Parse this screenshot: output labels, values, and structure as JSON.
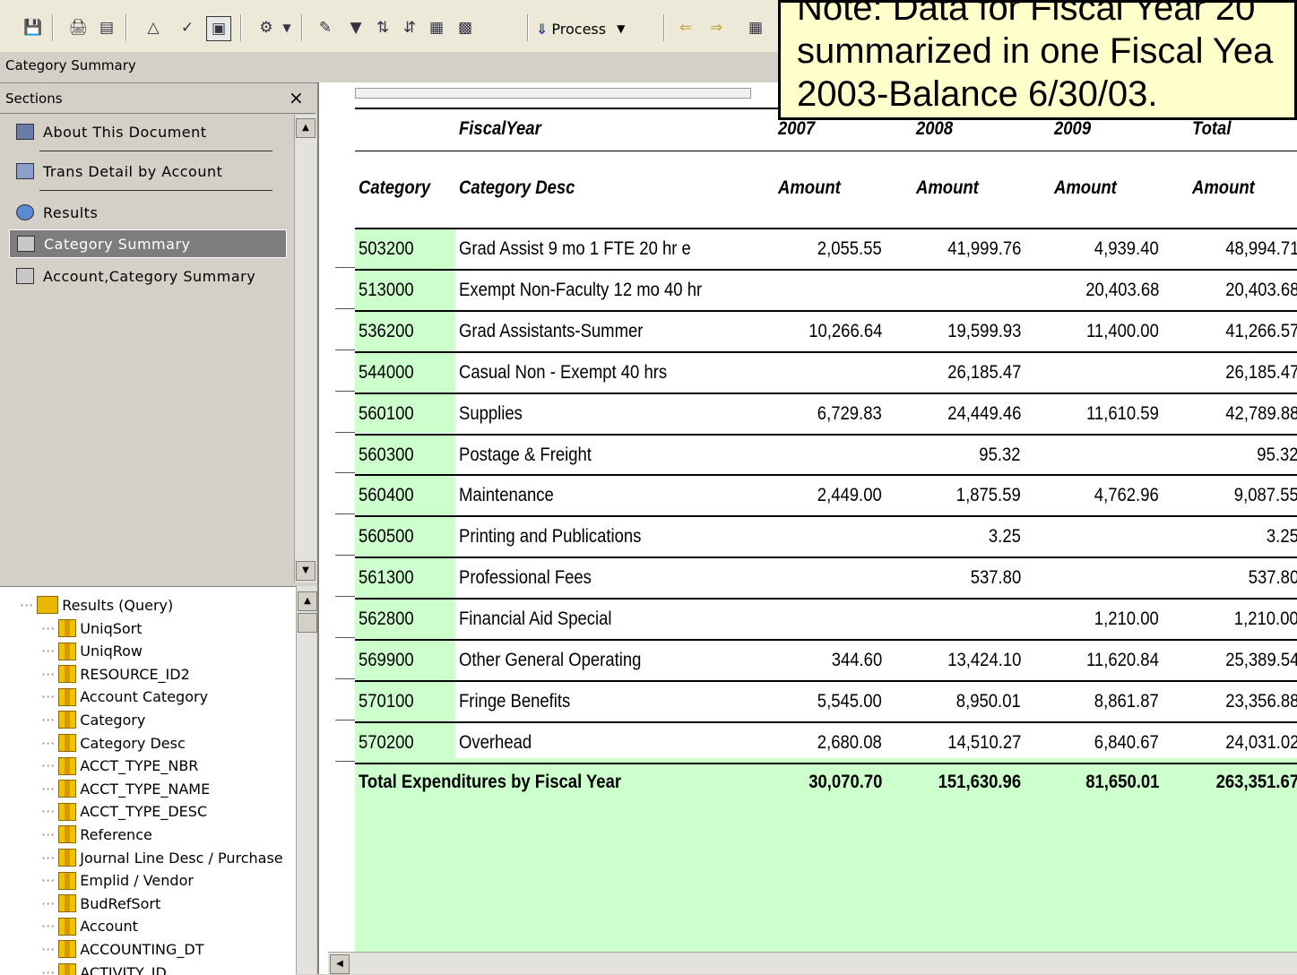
{
  "toolbar": {
    "process_label": "Process"
  },
  "window": {
    "title": "Category Summary"
  },
  "sections": {
    "header": "Sections",
    "close_glyph": "×",
    "items": [
      {
        "label": "About This Document",
        "icon": "document-info-icon"
      },
      {
        "label": "Trans Detail by Account",
        "icon": "report-icon"
      },
      {
        "label": "Results",
        "icon": "query-icon"
      },
      {
        "label": "Category Summary",
        "icon": "table-report-icon",
        "selected": true
      },
      {
        "label": "Account,Category Summary",
        "icon": "table-report-icon"
      }
    ]
  },
  "tree": {
    "root": "Results (Query)",
    "columns": [
      "UniqSort",
      "UniqRow",
      "RESOURCE_ID2",
      "Account Category",
      "Category",
      "Category Desc",
      "ACCT_TYPE_NBR",
      "ACCT_TYPE_NAME",
      "ACCT_TYPE_DESC",
      "Reference",
      "Journal Line Desc / Purchase",
      "Emplid / Vendor",
      "BudRefSort",
      "Account",
      "ACCOUNTING_DT",
      "ACTIVITY_ID"
    ]
  },
  "report": {
    "fiscal_year_label": "FiscalYear",
    "years": [
      "2007",
      "2008",
      "2009",
      "Total"
    ],
    "col_category": "Category",
    "col_desc": "Category Desc",
    "col_amount": "Amount",
    "rows": [
      {
        "code": "503200",
        "desc": "Grad Assist 9 mo 1 FTE 20 hr e",
        "y2007": "2,055.55",
        "y2008": "41,999.76",
        "y2009": "4,939.40",
        "total": "48,994.71"
      },
      {
        "code": "513000",
        "desc": "Exempt Non-Faculty 12 mo 40 hr",
        "y2007": "",
        "y2008": "",
        "y2009": "20,403.68",
        "total": "20,403.68"
      },
      {
        "code": "536200",
        "desc": "Grad Assistants-Summer",
        "y2007": "10,266.64",
        "y2008": "19,599.93",
        "y2009": "11,400.00",
        "total": "41,266.57"
      },
      {
        "code": "544000",
        "desc": "Casual Non - Exempt  40 hrs",
        "y2007": "",
        "y2008": "26,185.47",
        "y2009": "",
        "total": "26,185.47"
      },
      {
        "code": "560100",
        "desc": "Supplies",
        "y2007": "6,729.83",
        "y2008": "24,449.46",
        "y2009": "11,610.59",
        "total": "42,789.88"
      },
      {
        "code": "560300",
        "desc": "Postage & Freight",
        "y2007": "",
        "y2008": "95.32",
        "y2009": "",
        "total": "95.32"
      },
      {
        "code": "560400",
        "desc": "Maintenance",
        "y2007": "2,449.00",
        "y2008": "1,875.59",
        "y2009": "4,762.96",
        "total": "9,087.55"
      },
      {
        "code": "560500",
        "desc": "Printing and Publications",
        "y2007": "",
        "y2008": "3.25",
        "y2009": "",
        "total": "3.25"
      },
      {
        "code": "561300",
        "desc": "Professional Fees",
        "y2007": "",
        "y2008": "537.80",
        "y2009": "",
        "total": "537.80"
      },
      {
        "code": "562800",
        "desc": "Financial Aid Special",
        "y2007": "",
        "y2008": "",
        "y2009": "1,210.00",
        "total": "1,210.00"
      },
      {
        "code": "569900",
        "desc": "Other General Operating",
        "y2007": "344.60",
        "y2008": "13,424.10",
        "y2009": "11,620.84",
        "total": "25,389.54"
      },
      {
        "code": "570100",
        "desc": "Fringe Benefits",
        "y2007": "5,545.00",
        "y2008": "8,950.01",
        "y2009": "8,861.87",
        "total": "23,356.88"
      },
      {
        "code": "570200",
        "desc": "Overhead",
        "y2007": "2,680.08",
        "y2008": "14,510.27",
        "y2009": "6,840.67",
        "total": "24,031.02"
      }
    ],
    "totals": {
      "label": "Total Expenditures by Fiscal Year",
      "y2007": "30,070.70",
      "y2008": "151,630.96",
      "y2009": "81,650.01",
      "total": "263,351.67"
    }
  },
  "note": {
    "lines": [
      "Note:  Data for Fiscal Year 20",
      "summarized in one Fiscal Yea",
      "2003-Balance 6/30/03."
    ]
  },
  "colors": {
    "green_band": "#ccffcc",
    "note_bg": "#ffffcc",
    "selected_item": "#7d7d7d"
  }
}
